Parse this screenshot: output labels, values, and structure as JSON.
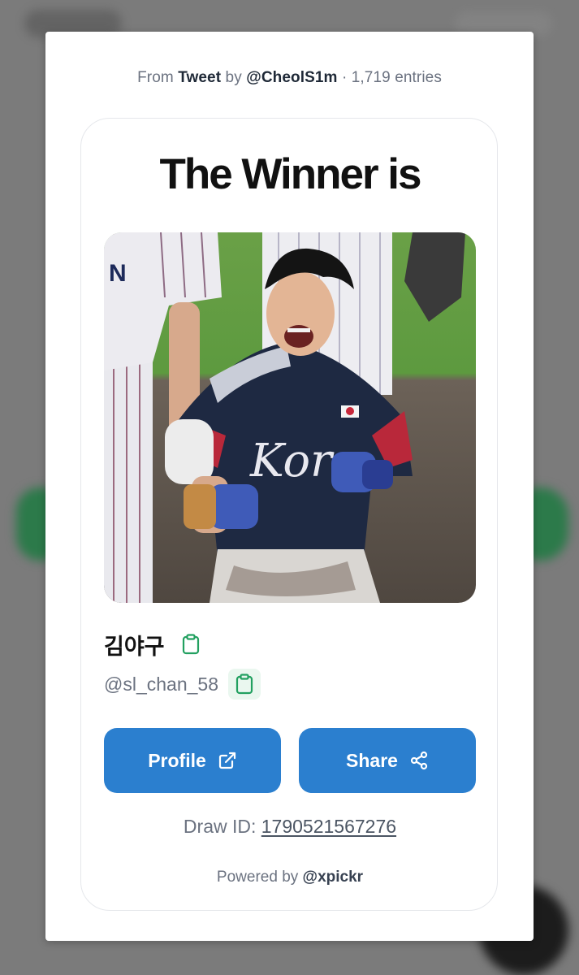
{
  "source": {
    "prefix": "From",
    "type": "Tweet",
    "by_label": "by",
    "author": "@CheolS1m",
    "separator": "·",
    "entries": "1,719 entries"
  },
  "result": {
    "title": "The Winner is",
    "winner_name": "김야구",
    "winner_handle": "@sl_chan_58",
    "photo_icon": "winner-photo"
  },
  "actions": {
    "profile_label": "Profile",
    "profile_icon": "external-link-icon",
    "share_label": "Share",
    "share_icon": "share-icon",
    "copy_icon": "clipboard-icon"
  },
  "draw": {
    "label": "Draw ID:",
    "id": "1790521567276"
  },
  "footer": {
    "powered_label": "Powered by",
    "brand": "@xpickr"
  },
  "colors": {
    "accent": "#2b7fcf",
    "copy_icon": "#22a060",
    "text_muted": "#6b7280",
    "backdrop": "#7b7b7b"
  }
}
